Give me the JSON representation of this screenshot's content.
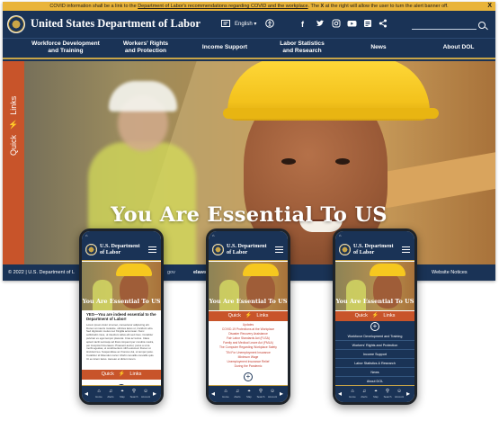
{
  "alert": {
    "text_before": "COVID information shall be a link to the ",
    "link_text": "Department of Labor's recommendations regarding COVID and the workplace",
    "text_middle": ". The ",
    "bold_x": "X",
    "text_after": " at the right will allow the user to turn the alert banner off.",
    "close": "X"
  },
  "header": {
    "title": "United States Department of Labor",
    "language": "English",
    "icons": [
      "translate-icon",
      "accessibility-icon",
      "facebook-icon",
      "twitter-icon",
      "instagram-icon",
      "youtube-icon",
      "rss-icon",
      "share-icon",
      "search-icon"
    ]
  },
  "nav": [
    {
      "line1": "Workforce Development",
      "line2": "and Training"
    },
    {
      "line1": "Workers' Rights",
      "line2": "and Protection"
    },
    {
      "line1": "Income Support",
      "line2": ""
    },
    {
      "line1": "Labor Statistics",
      "line2": "and Research"
    },
    {
      "line1": "News",
      "line2": ""
    },
    {
      "line1": "About DOL",
      "line2": ""
    }
  ],
  "quick_links": {
    "word1": "Quick",
    "word2": "Links",
    "bolt": "⚡"
  },
  "hero": {
    "heading": "You Are Essential To US"
  },
  "footer": {
    "copyright": "© 2022 | U.S. Department of L",
    "gov": "gov",
    "elaws": "elaws ·",
    "notices": "Website Notices"
  },
  "phone": {
    "title_line1": "U.S. Department",
    "title_line2": "of Labor",
    "hero_text": "You Are Essential To US",
    "quick": "Quick",
    "links": "Links",
    "tabs": [
      "Home",
      "Alerts",
      "Map",
      "Search",
      "Account"
    ]
  },
  "phone1": {
    "heading": "YES—You are indeed essential to the Department of Labor!",
    "body": "Lorem ipsum dolor sit amet, consectetur adipiscing elit. Donec at mauris molestie, ultricies lacus ut, tincidunt odio. Sed dignissim metus nec fringilla accumsan. Nunc sollicitudin risus, ut interdum tellus elit sed risus. Curabitur pulvinar ex eget tempor placerat. Cras ac lectus. Class aptent taciti sociosqu ad litora torquent per conubia nostra, per inceptos himenaeos. Praesent auctor, purus a urna morbi egestas, ut condimentum nibh euismod. Donec ut tincidunt leo. Suspendisse ac rhoncus dui, ut tempor justo. Curabitur id bibendum tortor. Morbi convallis convallis quis. Ut eu lorem lacus. Aenean et dictum lorem."
  },
  "phone2": {
    "items": [
      "Updates",
      "COVID-19 Protections at the Workplace",
      "Disaster Recovery Assistance",
      "Fair Labor Standards Act (FLSA)",
      "Family and Medical Leave Act (FMLA)",
      "The Computer Regarding Workplace Safety",
      "TIN For Unemployment Insurance",
      "Minimum Wage",
      "Unemployment Insurance Relief",
      "During the Pandemic"
    ]
  },
  "phone3": {
    "items": [
      "Workforce Development and Training",
      "Workers' Rights and Protection",
      "Income Support",
      "Labor Statistics & Research",
      "News",
      "About DOL"
    ]
  },
  "colors": {
    "navy": "#1a3356",
    "gold": "#c9a547",
    "alert": "#e9b43a",
    "quick": "#c8542a"
  }
}
